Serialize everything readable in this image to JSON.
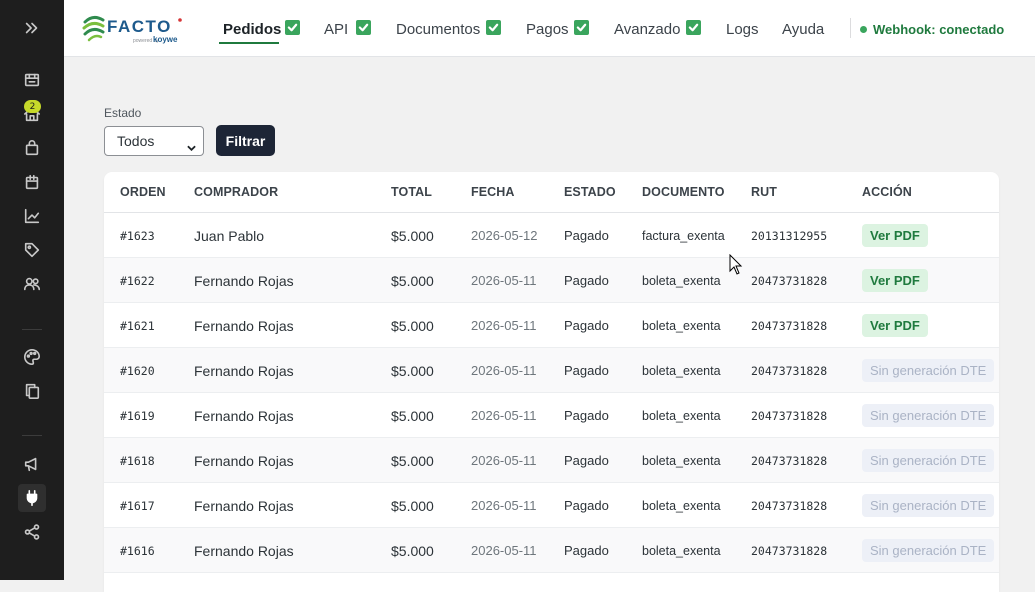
{
  "sidebar": {
    "badge_count": "2",
    "icons": [
      "expand-icon",
      "store-icon",
      "home-icon",
      "bag-icon",
      "bag-alt-icon",
      "chart-icon",
      "tag-icon",
      "users-icon",
      "palette-icon",
      "copy-icon",
      "megaphone-icon",
      "plug-icon",
      "share-icon"
    ]
  },
  "header": {
    "logo_text": "FACTO",
    "logo_sub": "powered by koywe",
    "nav": [
      {
        "label": "Pedidos",
        "active": true,
        "checked": true
      },
      {
        "label": "API",
        "checked": true
      },
      {
        "label": "Documentos",
        "checked": true
      },
      {
        "label": "Pagos",
        "checked": true
      },
      {
        "label": "Avanzado",
        "checked": true
      },
      {
        "label": "Logs"
      },
      {
        "label": "Ayuda"
      }
    ],
    "webhook_status": "Webhook: conectado"
  },
  "filter": {
    "label": "Estado",
    "selected": "Todos",
    "button_label": "Filtrar"
  },
  "table": {
    "columns": [
      "ORDEN",
      "COMPRADOR",
      "TOTAL",
      "FECHA",
      "ESTADO",
      "DOCUMENTO",
      "RUT",
      "ACCIÓN"
    ],
    "rows": [
      {
        "orden": "#1623",
        "comprador": "Juan Pablo",
        "total": "$5.000",
        "fecha": "2026-05-12",
        "estado": "Pagado",
        "documento": "factura_exenta",
        "rut": "20131312955",
        "accion": "Ver PDF",
        "accion_type": "pdf"
      },
      {
        "orden": "#1622",
        "comprador": "Fernando Rojas",
        "total": "$5.000",
        "fecha": "2026-05-11",
        "estado": "Pagado",
        "documento": "boleta_exenta",
        "rut": "20473731828",
        "accion": "Ver PDF",
        "accion_type": "pdf"
      },
      {
        "orden": "#1621",
        "comprador": "Fernando Rojas",
        "total": "$5.000",
        "fecha": "2026-05-11",
        "estado": "Pagado",
        "documento": "boleta_exenta",
        "rut": "20473731828",
        "accion": "Ver PDF",
        "accion_type": "pdf"
      },
      {
        "orden": "#1620",
        "comprador": "Fernando Rojas",
        "total": "$5.000",
        "fecha": "2026-05-11",
        "estado": "Pagado",
        "documento": "boleta_exenta",
        "rut": "20473731828",
        "accion": "Sin generación DTE",
        "accion_type": "none"
      },
      {
        "orden": "#1619",
        "comprador": "Fernando Rojas",
        "total": "$5.000",
        "fecha": "2026-05-11",
        "estado": "Pagado",
        "documento": "boleta_exenta",
        "rut": "20473731828",
        "accion": "Sin generación DTE",
        "accion_type": "none"
      },
      {
        "orden": "#1618",
        "comprador": "Fernando Rojas",
        "total": "$5.000",
        "fecha": "2026-05-11",
        "estado": "Pagado",
        "documento": "boleta_exenta",
        "rut": "20473731828",
        "accion": "Sin generación DTE",
        "accion_type": "none"
      },
      {
        "orden": "#1617",
        "comprador": "Fernando Rojas",
        "total": "$5.000",
        "fecha": "2026-05-11",
        "estado": "Pagado",
        "documento": "boleta_exenta",
        "rut": "20473731828",
        "accion": "Sin generación DTE",
        "accion_type": "none"
      },
      {
        "orden": "#1616",
        "comprador": "Fernando Rojas",
        "total": "$5.000",
        "fecha": "2026-05-11",
        "estado": "Pagado",
        "documento": "boleta_exenta",
        "rut": "20473731828",
        "accion": "Sin generación DTE",
        "accion_type": "none"
      }
    ]
  },
  "colors": {
    "sidebar_bg": "#1e1e1e",
    "accent_green": "#1f7a3e",
    "button_dark": "#1d2536",
    "badge_yellow": "#c6d92a"
  }
}
